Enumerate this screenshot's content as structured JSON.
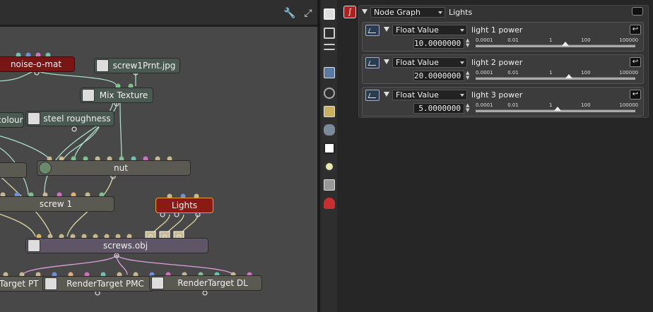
{
  "node_graph": {
    "nodes": {
      "noise": "noise-o-mat",
      "screw_print": "screw1Prnt.jpg",
      "mix": "Mix Texture",
      "colour": "colour",
      "steel": "steel roughness",
      "nut": "nut",
      "lights": "Lights",
      "screw1": "screw 1",
      "screws_obj": "screws.obj",
      "rt_pt": "Target PT",
      "rt_pmc": "RenderTarget PMC",
      "rt_dl": "RenderTarget DL"
    },
    "toolbar_icons": [
      "wrench-icon",
      "expand-icon"
    ]
  },
  "rail_icons": [
    "camera-settings-icon",
    "layers-icon",
    "list-icon",
    "image-icon",
    "camera-icon",
    "texture-icon",
    "database-icon",
    "picture-icon",
    "sun-icon",
    "noise-icon",
    "material-icon"
  ],
  "inspector": {
    "graph_type": "Node Graph",
    "graph_name": "Lights",
    "rows": [
      {
        "type": "Float Value",
        "name": "light 1 power",
        "value": "10.0000000",
        "scale": [
          "0.0001",
          "0.01",
          "1",
          "100",
          "100000"
        ],
        "level": 0.56
      },
      {
        "type": "Float Value",
        "name": "light 2 power",
        "value": "20.0000000",
        "scale": [
          "0.0001",
          "0.01",
          "1",
          "100",
          "100000"
        ],
        "level": 0.585
      },
      {
        "type": "Float Value",
        "name": "light 3 power",
        "value": "5.0000000",
        "scale": [
          "0.0001",
          "0.01",
          "1",
          "100",
          "100000"
        ],
        "level": 0.515
      }
    ]
  },
  "colors": {
    "pin_blue": "#6f8fd8",
    "pin_orange": "#e0b070",
    "pin_pink": "#d070c0",
    "pin_green": "#80c090",
    "pin_teal": "#70c0b0",
    "pin_tan": "#c8b890",
    "wire_green": "#a8dcc8",
    "wire_pink": "#e0a0e0",
    "wire_tan": "#e0d8a0"
  }
}
